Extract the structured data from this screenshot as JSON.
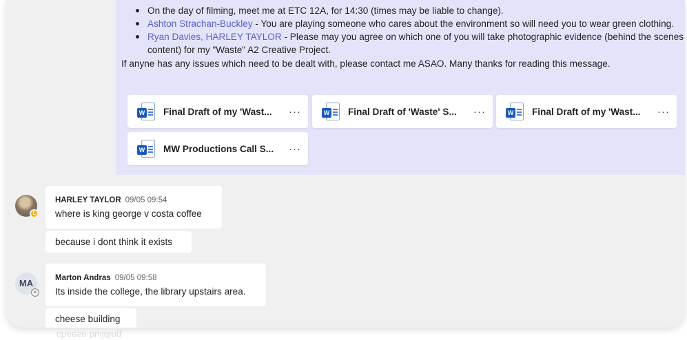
{
  "own_message": {
    "bullets": [
      {
        "mention": "",
        "text": "On the day of filming, meet me at ETC 12A, for 14:30 (times may be liable to change)."
      },
      {
        "mention": "Ashton Strachan-Buckley",
        "text": " - You are playing someone who cares about the environment so will need you to wear green clothing."
      },
      {
        "mention": "Ryan Davies, HARLEY TAYLOR",
        "text": " - Please may you agree on which one of you will take photographic evidence (behind the scenes content) for my \"Waste\" A2 Creative Project."
      }
    ],
    "closing": "If anyne has any issues which need to be dealt with, please contact me ASAO. Many thanks for reading this message.",
    "attachments": [
      {
        "name": "Final Draft of my 'Wast...",
        "icon": "word-file-icon"
      },
      {
        "name": "Final Draft of 'Waste' S...",
        "icon": "word-file-icon"
      },
      {
        "name": "Final Draft of my 'Wast...",
        "icon": "word-file-icon"
      },
      {
        "name": "MW Productions Call S...",
        "icon": "word-file-icon"
      }
    ],
    "more_label": "···"
  },
  "messages": [
    {
      "author": "HARLEY TAYLOR",
      "time": "09/05 09:54",
      "lines": [
        "where is king george v costa coffee",
        "because i dont think it exists"
      ],
      "status": "away"
    },
    {
      "author": "Marton Andras",
      "initials": "MA",
      "time": "09/05 09:58",
      "lines": [
        "Its inside the college, the library upstairs area.",
        "cheese building"
      ],
      "status": "offline"
    }
  ],
  "reflection_text": "cheese building",
  "colors": {
    "accent": "#5b5fc7",
    "own_bubble": "#e3e4f9",
    "background": "#f0f0f0",
    "word_blue": "#185abd"
  }
}
